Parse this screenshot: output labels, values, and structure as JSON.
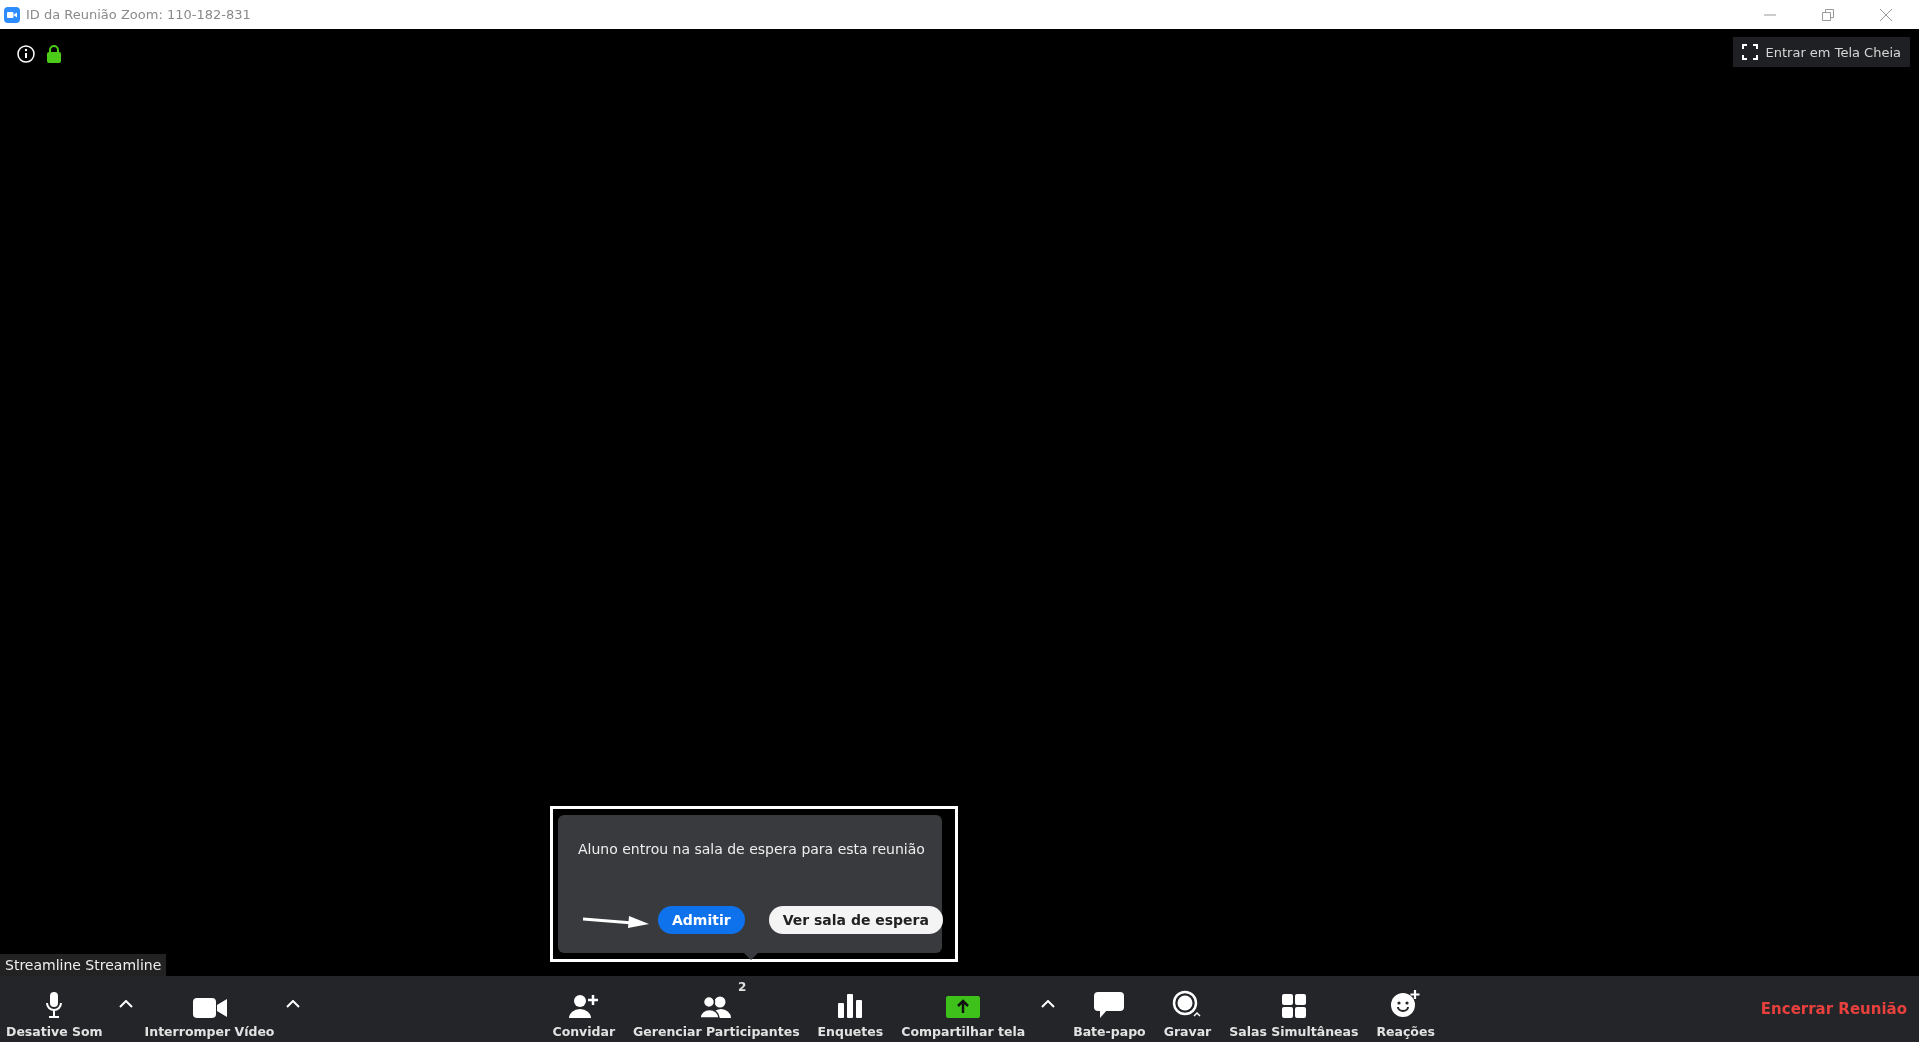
{
  "window": {
    "title": "ID da Reunião Zoom: 110-182-831"
  },
  "fullscreen_button": {
    "label": "Entrar em Tela Cheia"
  },
  "participant_name": "Streamline Streamline",
  "notification": {
    "message": "Aluno entrou na sala de espera para esta reunião",
    "buttons": [
      {
        "label": "Admitir",
        "kind": "primary"
      },
      {
        "label": "Ver sala de espera",
        "kind": "secondary"
      }
    ]
  },
  "toolbar": {
    "items": [
      {
        "kind": "button",
        "label": "Desative Som"
      },
      {
        "kind": "caret"
      },
      {
        "kind": "button",
        "label": "Interromper Vídeo"
      },
      {
        "kind": "caret"
      },
      {
        "kind": "button",
        "label": "Convidar"
      },
      {
        "kind": "button",
        "label": "Gerenciar Participantes",
        "count": "2"
      },
      {
        "kind": "button",
        "label": "Enquetes"
      },
      {
        "kind": "share",
        "label": "Compartilhar tela"
      },
      {
        "kind": "caret"
      },
      {
        "kind": "button",
        "label": "Bate-papo"
      },
      {
        "kind": "button",
        "label": "Gravar"
      },
      {
        "kind": "button",
        "label": "Salas Simultâneas"
      },
      {
        "kind": "button",
        "label": "Reações"
      }
    ],
    "end_button": {
      "label": "Encerrar Reunião"
    }
  }
}
